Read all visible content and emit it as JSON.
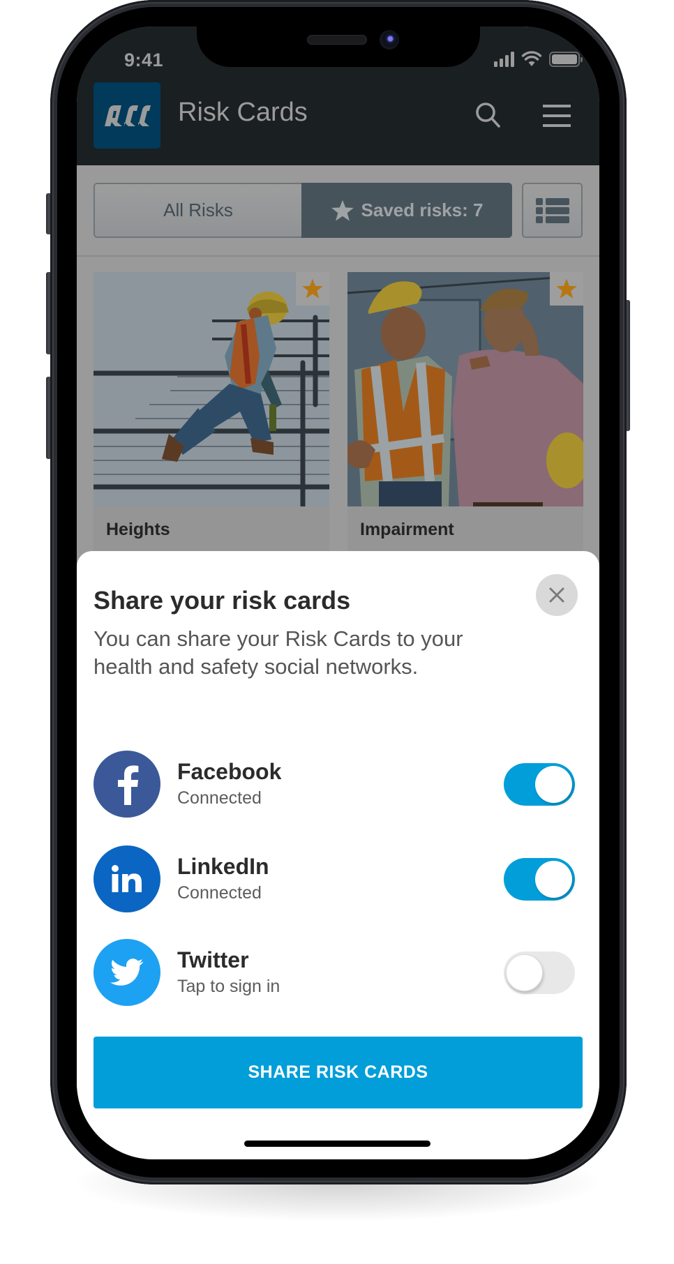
{
  "status_bar": {
    "time": "9:41",
    "icons": [
      "cellular-signal-icon",
      "wifi-icon",
      "battery-icon"
    ]
  },
  "header": {
    "logo_text": "ACC",
    "title": "Risk Cards",
    "icons": [
      "search-icon",
      "hamburger-menu-icon"
    ]
  },
  "filter": {
    "tabs": [
      {
        "label": "All Risks",
        "active": false
      },
      {
        "label": "Saved risks: 7",
        "active": true,
        "icon": "star-icon"
      }
    ],
    "view_toggle_icon": "list-view-icon"
  },
  "cards": [
    {
      "label": "Heights",
      "saved": true,
      "image": "worker-kneeling-on-scaffold-illustration"
    },
    {
      "label": "Impairment",
      "saved": true,
      "image": "supervisor-with-unwell-worker-illustration"
    }
  ],
  "share_sheet": {
    "title": "Share your risk cards",
    "description": "You can share your Risk Cards to your health and safety social networks.",
    "close_icon": "close-icon",
    "networks": [
      {
        "name": "Facebook",
        "status": "Connected",
        "enabled": true,
        "icon": "facebook-icon",
        "color": "#3B5998"
      },
      {
        "name": "LinkedIn",
        "status": "Connected",
        "enabled": true,
        "icon": "linkedin-icon",
        "color": "#0A66C2"
      },
      {
        "name": "Twitter",
        "status": "Tap to sign in",
        "enabled": false,
        "icon": "twitter-icon",
        "color": "#1DA1F2"
      }
    ],
    "share_button_label": "SHARE RISK CARDS"
  },
  "colors": {
    "accent": "#019ED9",
    "header_bg": "#1A1F22",
    "logo_bg": "#013A5A",
    "saved_tab_bg": "#46535B",
    "star": "#D38A16"
  }
}
